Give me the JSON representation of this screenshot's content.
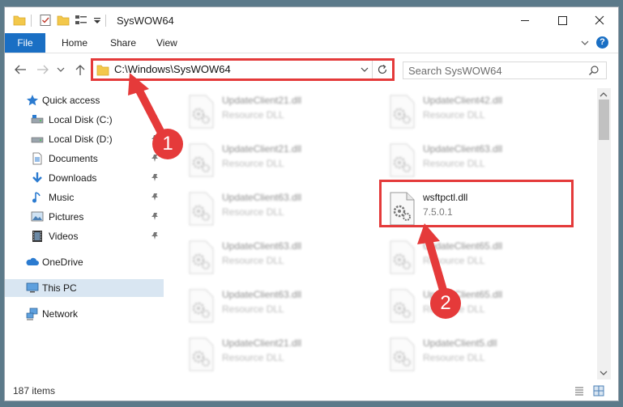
{
  "window": {
    "title": "SysWOW64"
  },
  "ribbon": {
    "tabs": [
      {
        "label": "File"
      },
      {
        "label": "Home"
      },
      {
        "label": "Share"
      },
      {
        "label": "View"
      }
    ],
    "help_label": "?"
  },
  "address_bar": {
    "path": "C:\\Windows\\SysWOW64"
  },
  "search": {
    "placeholder": "Search SysWOW64"
  },
  "sidebar": {
    "items": [
      {
        "label": "Quick access",
        "icon": "star-icon"
      },
      {
        "label": "Local Disk (C:)",
        "icon": "drive-icon"
      },
      {
        "label": "Local Disk (D:)",
        "icon": "drive-icon"
      },
      {
        "label": "Documents",
        "icon": "documents-icon"
      },
      {
        "label": "Downloads",
        "icon": "downloads-icon"
      },
      {
        "label": "Music",
        "icon": "music-icon"
      },
      {
        "label": "Pictures",
        "icon": "pictures-icon"
      },
      {
        "label": "Videos",
        "icon": "videos-icon"
      },
      {
        "label": "OneDrive",
        "icon": "onedrive-icon"
      },
      {
        "label": "This PC",
        "icon": "pc-icon"
      },
      {
        "label": "Network",
        "icon": "network-icon"
      }
    ]
  },
  "files": [
    {
      "name": "UpdateClient21.dll",
      "type": "Resource DLL"
    },
    {
      "name": "UpdateClient42.dll",
      "type": "Resource DLL"
    },
    {
      "name": "UpdateClient21.dll",
      "type": "Resource DLL"
    },
    {
      "name": "UpdateClient63.dll",
      "type": "Resource DLL"
    },
    {
      "name": "UpdateClient63.dll",
      "type": "Resource DLL"
    },
    {
      "name": "wsftpctl.dll",
      "type": "7.5.0.1"
    },
    {
      "name": "UpdateClient63.dll",
      "type": "Resource DLL"
    },
    {
      "name": "UpdateClient65.dll",
      "type": "Resource DLL"
    },
    {
      "name": "UpdateClient63.dll",
      "type": "Resource DLL"
    },
    {
      "name": "UpdateClient65.dll",
      "type": "Resource DLL"
    },
    {
      "name": "UpdateClient21.dll",
      "type": "Resource DLL"
    },
    {
      "name": "UpdateClient5.dll",
      "type": "Resource DLL"
    }
  ],
  "status": {
    "item_count": "187 items"
  },
  "annotations": {
    "step1": "1",
    "step2": "2"
  },
  "colors": {
    "accent": "#1a6fc4",
    "annotation_red": "#e43a3a",
    "selection": "#d9e6f2"
  }
}
